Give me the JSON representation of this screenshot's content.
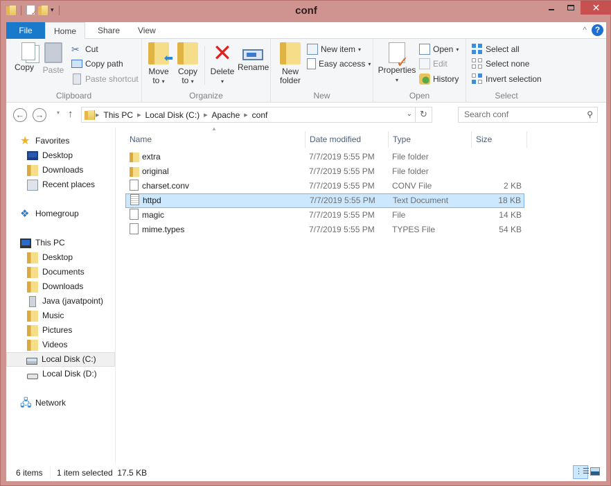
{
  "window": {
    "title": "conf",
    "controls": {
      "minimize": "–",
      "maximize": "☐",
      "close": "✕"
    }
  },
  "quick_access": {
    "icons": [
      "folder-icon",
      "properties-icon",
      "new-folder-icon",
      "customize-dropdown-icon"
    ],
    "dropdown": "▾"
  },
  "ribbon_tabs": [
    {
      "label": "File",
      "active": false
    },
    {
      "label": "Home",
      "active": true
    },
    {
      "label": "Share",
      "active": false
    },
    {
      "label": "View",
      "active": false
    }
  ],
  "ribbon": {
    "collapse": "^",
    "help": "?",
    "clipboard": {
      "label": "Clipboard",
      "copy": "Copy",
      "paste": "Paste",
      "cut": "Cut",
      "copy_path": "Copy path",
      "paste_shortcut": "Paste shortcut"
    },
    "organize": {
      "label": "Organize",
      "move_to": "Move",
      "move_to_2": "to",
      "copy_to": "Copy",
      "copy_to_2": "to",
      "delete": "Delete",
      "rename": "Rename"
    },
    "new": {
      "label": "New",
      "new_folder": "New",
      "new_folder_2": "folder",
      "new_item": "New item",
      "easy_access": "Easy access"
    },
    "open": {
      "label": "Open",
      "properties": "Properties",
      "open": "Open",
      "edit": "Edit",
      "history": "History"
    },
    "select": {
      "label": "Select",
      "select_all": "Select all",
      "select_none": "Select none",
      "invert_selection": "Invert selection"
    }
  },
  "navigation": {
    "back": "←",
    "forward": "→",
    "recent": "▾",
    "up": "↑",
    "breadcrumb": [
      "This PC",
      "Local Disk (C:)",
      "Apache",
      "conf"
    ],
    "search_placeholder": "Search conf"
  },
  "nav_pane": {
    "favorites": {
      "label": "Favorites",
      "items": [
        "Desktop",
        "Downloads",
        "Recent places"
      ]
    },
    "homegroup": "Homegroup",
    "this_pc": {
      "label": "This PC",
      "items": [
        "Desktop",
        "Documents",
        "Downloads",
        "Java (javatpoint)",
        "Music",
        "Pictures",
        "Videos",
        "Local Disk (C:)",
        "Local Disk (D:)"
      ],
      "selected": "Local Disk (C:)"
    },
    "network": "Network"
  },
  "file_list": {
    "columns": {
      "name": "Name",
      "date": "Date modified",
      "type": "Type",
      "size": "Size"
    },
    "sort_column": "Name",
    "rows": [
      {
        "name": "extra",
        "date": "7/7/2019 5:55 PM",
        "type": "File folder",
        "size": "",
        "icon": "folder",
        "selected": false
      },
      {
        "name": "original",
        "date": "7/7/2019 5:55 PM",
        "type": "File folder",
        "size": "",
        "icon": "folder",
        "selected": false
      },
      {
        "name": "charset.conv",
        "date": "7/7/2019 5:55 PM",
        "type": "CONV File",
        "size": "2 KB",
        "icon": "file",
        "selected": false
      },
      {
        "name": "httpd",
        "date": "7/7/2019 5:55 PM",
        "type": "Text Document",
        "size": "18 KB",
        "icon": "text",
        "selected": true
      },
      {
        "name": "magic",
        "date": "7/7/2019 5:55 PM",
        "type": "File",
        "size": "14 KB",
        "icon": "file",
        "selected": false
      },
      {
        "name": "mime.types",
        "date": "7/7/2019 5:55 PM",
        "type": "TYPES File",
        "size": "54 KB",
        "icon": "file",
        "selected": false
      }
    ]
  },
  "status_bar": {
    "item_count": "6 items",
    "selection": "1 item selected  17.5 KB",
    "view_mode": "details"
  },
  "colors": {
    "window_frame": "#d09490",
    "file_tab": "#1979ca",
    "selection_fill": "#cce8ff",
    "selection_border": "#7eb4ea",
    "close_button": "#c75050"
  }
}
